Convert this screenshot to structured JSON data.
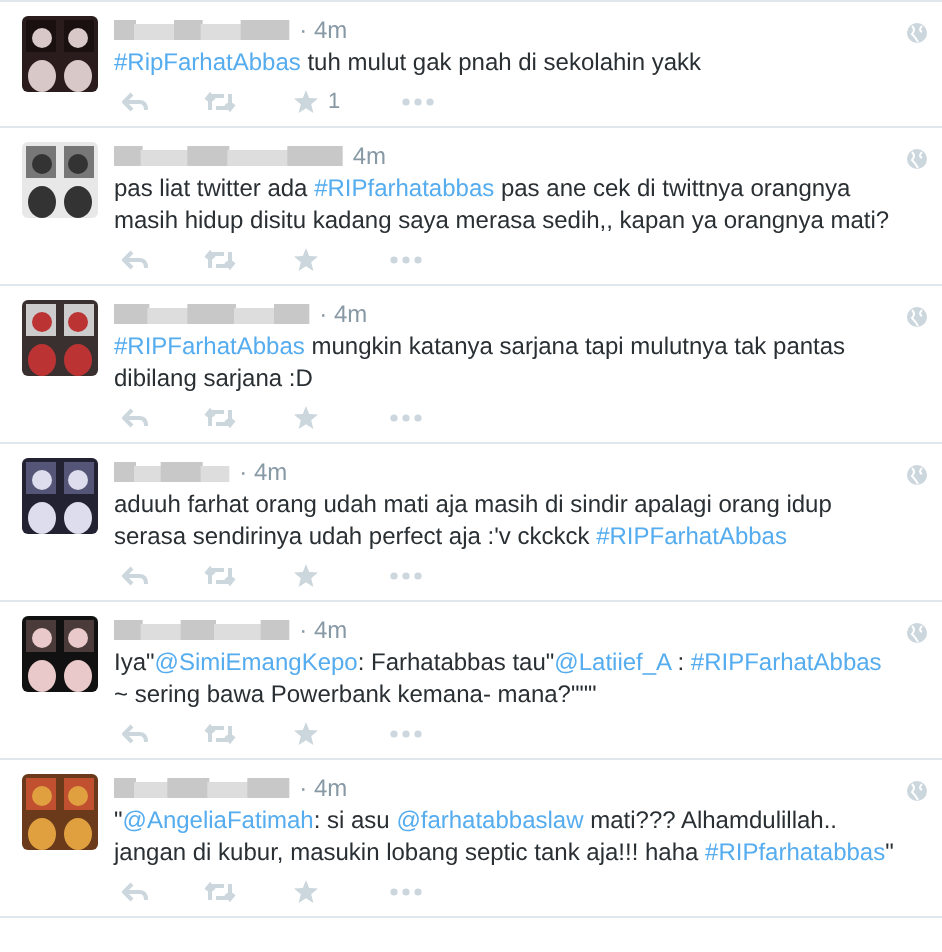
{
  "tweets": [
    {
      "time": "· 4m",
      "text": [
        {
          "kind": "link",
          "text": "#RipFarhatAbbas"
        },
        {
          "kind": "text",
          "text": " tuh mulut gak pnah di sekolahin yakk"
        }
      ],
      "favorites": "1"
    },
    {
      "time": "4m",
      "text": [
        {
          "kind": "text",
          "text": "pas liat twitter ada "
        },
        {
          "kind": "link",
          "text": "#RIPfarhatabbas"
        },
        {
          "kind": "text",
          "text": " pas ane cek di twittnya orangnya masih hidup disitu kadang saya merasa sedih,, kapan ya orangnya mati?"
        }
      ]
    },
    {
      "time": "· 4m",
      "text": [
        {
          "kind": "link",
          "text": "#RIPFarhatAbbas"
        },
        {
          "kind": "text",
          "text": " mungkin katanya sarjana tapi mulutnya tak pantas dibilang sarjana :D"
        }
      ]
    },
    {
      "time": "· 4m",
      "text": [
        {
          "kind": "text",
          "text": "aduuh farhat orang udah mati aja masih di sindir apalagi orang idup serasa sendirinya udah perfect aja :'v ckckck "
        },
        {
          "kind": "link",
          "text": "#RIPFarhatAbbas"
        }
      ]
    },
    {
      "time": "· 4m",
      "text": [
        {
          "kind": "text",
          "text": "Iya\""
        },
        {
          "kind": "link",
          "text": "@SimiEmangKepo"
        },
        {
          "kind": "text",
          "text": ": Farhatabbas tau\""
        },
        {
          "kind": "link",
          "text": "@Latiief_A"
        },
        {
          "kind": "text",
          "text": " : "
        },
        {
          "kind": "link",
          "text": "#RIPFarhatAbbas"
        },
        {
          "kind": "text",
          "text": " ~ sering bawa Powerbank kemana- mana?\"\"\""
        }
      ]
    },
    {
      "time": "· 4m",
      "text": [
        {
          "kind": "text",
          "text": "\""
        },
        {
          "kind": "link",
          "text": "@AngeliaFatimah"
        },
        {
          "kind": "text",
          "text": ": si asu "
        },
        {
          "kind": "link",
          "text": "@farhatabbaslaw"
        },
        {
          "kind": "text",
          "text": " mati???  Alhamdulillah..  jangan di kubur, masukin lobang septic tank aja!!!  haha "
        },
        {
          "kind": "link",
          "text": "#RIPfarhatabbas"
        },
        {
          "kind": "text",
          "text": "\""
        }
      ]
    }
  ]
}
